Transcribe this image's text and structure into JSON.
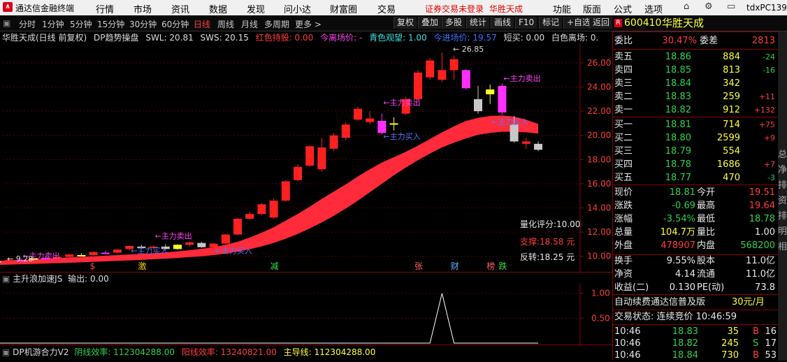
{
  "app": {
    "name": "通达信金融终端",
    "menu": [
      "行情",
      "市场",
      "资讯",
      "数据",
      "发现",
      "问小达",
      "财富圈",
      "交易"
    ],
    "notice": "证券交易未登录",
    "stock_red": "华胜天成",
    "right_menu": [
      "功能",
      "版面",
      "公式",
      "选项"
    ],
    "user": "tdxPC1397"
  },
  "periods": [
    "分时",
    "1分钟",
    "5分钟",
    "15分钟",
    "30分钟",
    "60分钟",
    "日线",
    "周线",
    "月线",
    "多周期",
    "更多 >"
  ],
  "active_period": "日线",
  "tools": [
    "复权",
    "叠加",
    "多股",
    "统计",
    "画线",
    "F10",
    "标记",
    "+自选",
    "返回"
  ],
  "indicator_bar": {
    "title": "华胜天成(日线 前复权)",
    "formula": "DP趋势操盘",
    "swl": "SWL: 20.81",
    "sws": "SWS: 20.15",
    "hold_label": "红色持股: 0.00",
    "leave_label": "今离场价: -",
    "watch_label": "青色观望: 1.00",
    "leave2_label": "今进场价: 19.57",
    "short_label": "短买: 0.00",
    "white_label": "白色离场: 0."
  },
  "chart_data": {
    "type": "candlestick",
    "y_axis_ticks": [
      10,
      12,
      14,
      16,
      18,
      20,
      22,
      24,
      26
    ],
    "ylim": [
      9.0,
      27.5
    ],
    "candles": [
      {
        "o": 9.3,
        "h": 9.4,
        "l": 9.2,
        "c": 9.28,
        "color": "magenta"
      },
      {
        "o": 9.35,
        "h": 9.45,
        "l": 9.3,
        "c": 9.4,
        "color": "red"
      },
      {
        "o": 9.45,
        "h": 9.55,
        "l": 9.4,
        "c": 9.5,
        "color": "magenta"
      },
      {
        "o": 9.55,
        "h": 9.7,
        "l": 9.5,
        "c": 9.65,
        "color": "yellow"
      },
      {
        "o": 9.6,
        "h": 9.7,
        "l": 9.5,
        "c": 9.55,
        "color": "white"
      },
      {
        "o": 9.55,
        "h": 9.75,
        "l": 9.5,
        "c": 9.7,
        "color": "red"
      },
      {
        "o": 9.7,
        "h": 9.8,
        "l": 9.6,
        "c": 9.65,
        "color": "magenta"
      },
      {
        "o": 9.7,
        "h": 9.9,
        "l": 9.65,
        "c": 9.85,
        "color": "yellow"
      },
      {
        "o": 9.85,
        "h": 9.95,
        "l": 9.7,
        "c": 9.75,
        "color": "magenta"
      },
      {
        "o": 9.8,
        "h": 10.0,
        "l": 9.75,
        "c": 9.95,
        "color": "red"
      },
      {
        "o": 9.95,
        "h": 10.2,
        "l": 9.9,
        "c": 10.15,
        "color": "red"
      },
      {
        "o": 10.1,
        "h": 10.25,
        "l": 10.0,
        "c": 10.05,
        "color": "yellow"
      },
      {
        "o": 10.1,
        "h": 10.4,
        "l": 10.05,
        "c": 10.35,
        "color": "red"
      },
      {
        "o": 10.3,
        "h": 10.45,
        "l": 10.2,
        "c": 10.25,
        "color": "magenta"
      },
      {
        "o": 10.3,
        "h": 10.6,
        "l": 10.25,
        "c": 10.55,
        "color": "red"
      },
      {
        "o": 10.6,
        "h": 10.9,
        "l": 10.5,
        "c": 10.85,
        "color": "red"
      },
      {
        "o": 10.8,
        "h": 10.95,
        "l": 10.6,
        "c": 10.7,
        "color": "white"
      },
      {
        "o": 10.7,
        "h": 10.9,
        "l": 10.6,
        "c": 10.8,
        "color": "red"
      },
      {
        "o": 10.8,
        "h": 11.0,
        "l": 10.55,
        "c": 10.6,
        "color": "white"
      },
      {
        "o": 10.6,
        "h": 11.0,
        "l": 10.55,
        "c": 10.95,
        "color": "yellow"
      },
      {
        "o": 10.95,
        "h": 11.2,
        "l": 10.8,
        "c": 11.15,
        "color": "red"
      },
      {
        "o": 11.1,
        "h": 11.2,
        "l": 10.7,
        "c": 10.75,
        "color": "white"
      },
      {
        "o": 10.75,
        "h": 11.1,
        "l": 10.7,
        "c": 11.05,
        "color": "red"
      },
      {
        "o": 11.05,
        "h": 11.85,
        "l": 11.0,
        "c": 11.8,
        "color": "red"
      },
      {
        "o": 11.8,
        "h": 13.2,
        "l": 11.75,
        "c": 13.1,
        "color": "red"
      },
      {
        "o": 13.1,
        "h": 13.7,
        "l": 13.0,
        "c": 13.5,
        "color": "red"
      },
      {
        "o": 13.5,
        "h": 14.4,
        "l": 13.4,
        "c": 14.3,
        "color": "red"
      },
      {
        "o": 13.2,
        "h": 14.8,
        "l": 13.1,
        "c": 14.6,
        "color": "red"
      },
      {
        "o": 14.6,
        "h": 16.3,
        "l": 14.5,
        "c": 16.2,
        "color": "red"
      },
      {
        "o": 16.3,
        "h": 17.6,
        "l": 16.2,
        "c": 17.4,
        "color": "red"
      },
      {
        "o": 17.5,
        "h": 19.2,
        "l": 17.4,
        "c": 19.1,
        "color": "red"
      },
      {
        "o": 17.2,
        "h": 19.8,
        "l": 17.0,
        "c": 19.0,
        "color": "red"
      },
      {
        "o": 18.9,
        "h": 20.2,
        "l": 18.7,
        "c": 20.0,
        "color": "red"
      },
      {
        "o": 19.8,
        "h": 21.1,
        "l": 19.6,
        "c": 20.9,
        "color": "red"
      },
      {
        "o": 21.3,
        "h": 22.4,
        "l": 21.2,
        "c": 22.2,
        "color": "red"
      },
      {
        "o": 21.4,
        "h": 22.0,
        "l": 20.9,
        "c": 21.1,
        "color": "red"
      },
      {
        "o": 21.2,
        "h": 21.8,
        "l": 20.1,
        "c": 20.2,
        "color": "magenta"
      },
      {
        "o": 20.9,
        "h": 21.5,
        "l": 20.4,
        "c": 21.0,
        "color": "yellow"
      },
      {
        "o": 21.8,
        "h": 23.2,
        "l": 21.7,
        "c": 23.0,
        "color": "red"
      },
      {
        "o": 23.0,
        "h": 25.4,
        "l": 22.9,
        "c": 25.2,
        "color": "red"
      },
      {
        "o": 24.8,
        "h": 26.4,
        "l": 24.6,
        "c": 26.2,
        "color": "red"
      },
      {
        "o": 24.6,
        "h": 26.85,
        "l": 24.4,
        "c": 25.4,
        "color": "red"
      },
      {
        "o": 25.4,
        "h": 26.6,
        "l": 24.6,
        "c": 26.3,
        "color": "red"
      },
      {
        "o": 25.4,
        "h": 25.5,
        "l": 23.8,
        "c": 23.9,
        "color": "magenta"
      },
      {
        "o": 23.0,
        "h": 24.1,
        "l": 21.8,
        "c": 22.0,
        "color": "white"
      },
      {
        "o": 23.4,
        "h": 24.2,
        "l": 22.6,
        "c": 23.8,
        "color": "yellow"
      },
      {
        "o": 24.1,
        "h": 24.3,
        "l": 21.7,
        "c": 21.9,
        "color": "magenta"
      },
      {
        "o": 20.9,
        "h": 21.6,
        "l": 19.4,
        "c": 19.5,
        "color": "white"
      },
      {
        "o": 19.5,
        "h": 19.8,
        "l": 18.9,
        "c": 19.3,
        "color": "red"
      },
      {
        "o": 19.3,
        "h": 19.5,
        "l": 18.7,
        "c": 18.81,
        "color": "white"
      }
    ],
    "band_upper": [
      9.5,
      9.52,
      9.55,
      9.58,
      9.62,
      9.66,
      9.7,
      9.75,
      9.8,
      9.85,
      9.9,
      9.95,
      10.0,
      10.05,
      10.1,
      10.15,
      10.2,
      10.25,
      10.32,
      10.4,
      10.5,
      10.62,
      10.75,
      10.95,
      11.2,
      11.55,
      11.95,
      12.4,
      12.95,
      13.5,
      14.1,
      14.75,
      15.35,
      15.95,
      16.6,
      17.2,
      17.75,
      18.2,
      18.65,
      19.15,
      19.7,
      20.25,
      20.75,
      21.2,
      21.45,
      21.6,
      21.65,
      21.55,
      21.3,
      20.95
    ],
    "band_lower": [
      9.2,
      9.22,
      9.24,
      9.26,
      9.28,
      9.31,
      9.34,
      9.37,
      9.4,
      9.43,
      9.46,
      9.5,
      9.54,
      9.58,
      9.62,
      9.66,
      9.7,
      9.75,
      9.8,
      9.86,
      9.93,
      10.0,
      10.1,
      10.22,
      10.38,
      10.58,
      10.82,
      11.1,
      11.45,
      11.85,
      12.3,
      12.8,
      13.35,
      13.95,
      14.6,
      15.3,
      16.0,
      16.7,
      17.35,
      17.95,
      18.5,
      19.0,
      19.4,
      19.75,
      20.05,
      20.2,
      20.3,
      20.3,
      20.25,
      20.15
    ],
    "high_label": "26.85",
    "low_label": "9.28",
    "buy_sell_labels": [
      {
        "text": "←主力卖出",
        "i": 1,
        "price": 9.55,
        "color": "magenta"
      },
      {
        "text": "←主力卖出",
        "i": 6,
        "price": 9.82,
        "color": "magenta"
      },
      {
        "text": "←主力买入",
        "i": 15,
        "price": 10.25,
        "color": "blue"
      },
      {
        "text": "←主力卖出",
        "i": 17,
        "price": 11.45,
        "color": "magenta"
      },
      {
        "text": "←主力买入",
        "i": 22,
        "price": 10.25,
        "color": "blue"
      },
      {
        "text": "←主力卖出",
        "i": 36,
        "price": 22.5,
        "color": "magenta"
      },
      {
        "text": "←主力买入",
        "i": 36,
        "price": 19.7,
        "color": "blue"
      },
      {
        "text": "←主力卖出",
        "i": 46,
        "price": 24.5,
        "color": "magenta"
      },
      {
        "text": "←主力买入",
        "i": 45,
        "price": 20.9,
        "color": "blue"
      }
    ],
    "badges": [
      {
        "text": "$",
        "i": 12,
        "color": "#ff4040"
      },
      {
        "text": "激",
        "i": 16,
        "color": "#ffd000"
      },
      {
        "text": "减",
        "i": 27,
        "color": "#30e050"
      },
      {
        "text": "张",
        "i": 39,
        "color": "#ff6060"
      },
      {
        "text": "财",
        "i": 42,
        "color": "#60b0ff"
      },
      {
        "text": "榜",
        "i": 45,
        "color": "#ff6060"
      },
      {
        "text": "跌",
        "i": 46,
        "color": "#30e050"
      }
    ],
    "scores": {
      "rating": "量化评分:10.00",
      "support": "支撑:18.58 元",
      "reversal": "反转:18.25 元"
    },
    "sub_indicator": {
      "title": "主升浪加速JS",
      "output": "输出: 0.00",
      "y_axis_ticks": [
        0.5,
        1.0
      ],
      "ylim": [
        0,
        1.15
      ],
      "values": [
        0,
        0,
        0,
        0,
        0,
        0,
        0,
        0,
        0,
        0,
        0,
        0,
        0,
        0,
        0,
        0,
        0,
        0,
        0,
        0,
        0,
        0,
        0,
        0,
        0,
        0,
        0,
        0,
        0,
        0,
        0,
        0,
        0,
        0,
        0,
        0,
        0,
        0,
        0,
        0,
        0,
        1,
        0,
        0,
        0,
        0,
        0,
        0,
        0,
        0
      ]
    }
  },
  "bottom_indicator": {
    "title": "DP机游合力V2",
    "yin": "阴线效率: 112304288.00",
    "yang": "阳线效率: 13240821.00",
    "main": "主导线: 112304288.00"
  },
  "quote": {
    "code": "600410",
    "name": "华胜天成",
    "weibi_label": "委比",
    "weibi": "30.47%",
    "weicha_label": "委差",
    "weicha": "2813",
    "asks": [
      {
        "label": "卖五",
        "price": "18.86",
        "vol": "884",
        "chg": "-24"
      },
      {
        "label": "卖四",
        "price": "18.85",
        "vol": "813",
        "chg": "-16"
      },
      {
        "label": "卖三",
        "price": "18.84",
        "vol": "342",
        "chg": ""
      },
      {
        "label": "卖二",
        "price": "18.83",
        "vol": "259",
        "chg": "+11"
      },
      {
        "label": "卖一",
        "price": "18.82",
        "vol": "912",
        "chg": "+132"
      }
    ],
    "bids": [
      {
        "label": "买一",
        "price": "18.81",
        "vol": "714",
        "chg": "+75"
      },
      {
        "label": "买二",
        "price": "18.80",
        "vol": "2599",
        "chg": "+9"
      },
      {
        "label": "买三",
        "price": "18.79",
        "vol": "554",
        "chg": ""
      },
      {
        "label": "买四",
        "price": "18.78",
        "vol": "1686",
        "chg": "+7"
      },
      {
        "label": "买五",
        "price": "18.77",
        "vol": "470",
        "chg": "-3"
      }
    ],
    "stats": [
      {
        "l1": "现价",
        "v1": "18.81",
        "c1": "green",
        "l2": "今开",
        "v2": "19.51",
        "c2": "red"
      },
      {
        "l1": "涨跌",
        "v1": "-0.69",
        "c1": "green",
        "l2": "最高",
        "v2": "19.64",
        "c2": "red"
      },
      {
        "l1": "涨幅",
        "v1": "-3.54%",
        "c1": "green",
        "l2": "最低",
        "v2": "18.78",
        "c2": "green"
      },
      {
        "l1": "总量",
        "v1": "104.7万",
        "c1": "yellow",
        "l2": "量比",
        "v2": "1.00",
        "c2": "white"
      },
      {
        "l1": "外盘",
        "v1": "478907",
        "c1": "red",
        "l2": "内盘",
        "v2": "568200",
        "c2": "green"
      }
    ],
    "stats2": [
      {
        "l1": "换手",
        "v1": "9.55%",
        "l2": "股本",
        "v2": "11.0亿"
      },
      {
        "l1": "净资",
        "v1": "4.14",
        "l2": "流通",
        "v2": "11.0亿"
      },
      {
        "l1": "收益(二)",
        "v1": "0.130",
        "l2": "PE(动)",
        "v2": "73.8"
      }
    ],
    "promo": "自动续费通达信普及版",
    "promo_price": "30元/月",
    "trade_status": "交易状态: 连续竞价 10:46:59",
    "ticks": [
      {
        "time": "10:46",
        "price": "18.83",
        "vol": "35",
        "bs": "B",
        "n": "16",
        "pc": "green",
        "bc": "red"
      },
      {
        "time": "10:46",
        "price": "18.82",
        "vol": "245",
        "bs": "S",
        "n": "17",
        "pc": "green",
        "bc": "green"
      },
      {
        "time": "10:46",
        "price": "18.84",
        "vol": "730",
        "bs": "B",
        "n": "53",
        "pc": "green",
        "bc": "red"
      }
    ]
  },
  "edge_labels": [
    "总",
    "净",
    "排",
    "资",
    "排",
    "明",
    "相"
  ]
}
